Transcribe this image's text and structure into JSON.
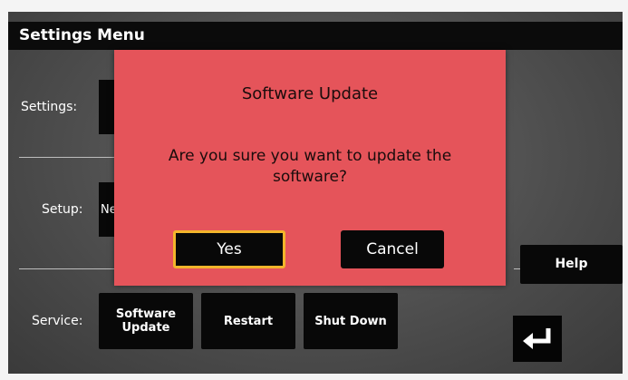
{
  "header": {
    "title": "Settings Menu"
  },
  "rows": {
    "settings_label": "Settings:",
    "setup_label": "Setup:",
    "setup_stub_text": "Ne",
    "service_label": "Service:"
  },
  "service_buttons": {
    "software_update_line1": "Software",
    "software_update_line2": "Update",
    "restart": "Restart",
    "shut_down": "Shut Down"
  },
  "side_buttons": {
    "help": "Help"
  },
  "dialog": {
    "title": "Software Update",
    "message": "Are you sure you want to update the software?",
    "yes_label": "Yes",
    "cancel_label": "Cancel",
    "background_color": "#e5545a",
    "focus_color": "#f2b52b"
  },
  "icons": {
    "back": "return-arrow-icon"
  }
}
